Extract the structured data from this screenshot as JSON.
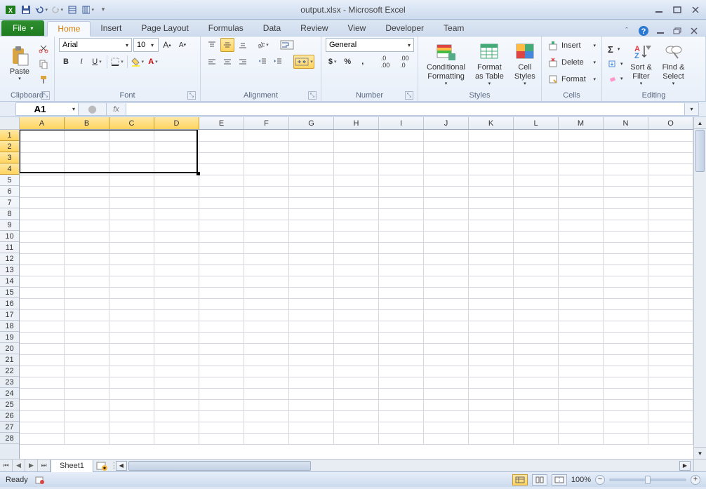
{
  "title": "output.xlsx - Microsoft Excel",
  "qat": {
    "save": "save",
    "undo": "undo",
    "redo": "redo"
  },
  "tabs": {
    "file": "File",
    "items": [
      "Home",
      "Insert",
      "Page Layout",
      "Formulas",
      "Data",
      "Review",
      "View",
      "Developer",
      "Team"
    ],
    "active": "Home"
  },
  "ribbon": {
    "clipboard": {
      "label": "Clipboard",
      "paste": "Paste"
    },
    "font": {
      "label": "Font",
      "name": "Arial",
      "size": "10"
    },
    "alignment": {
      "label": "Alignment"
    },
    "number": {
      "label": "Number",
      "format": "General"
    },
    "styles": {
      "label": "Styles",
      "cond": "Conditional\nFormatting",
      "table": "Format\nas Table",
      "cell": "Cell\nStyles"
    },
    "cells": {
      "label": "Cells",
      "insert": "Insert",
      "delete": "Delete",
      "format": "Format"
    },
    "editing": {
      "label": "Editing",
      "sort": "Sort &\nFilter",
      "find": "Find &\nSelect"
    }
  },
  "namebox": "A1",
  "fx": "fx",
  "columns": [
    "A",
    "B",
    "C",
    "D",
    "E",
    "F",
    "G",
    "H",
    "I",
    "J",
    "K",
    "L",
    "M",
    "N",
    "O"
  ],
  "rows": [
    "1",
    "2",
    "3",
    "4",
    "5",
    "6",
    "7",
    "8",
    "9",
    "10",
    "11",
    "12",
    "13",
    "14",
    "15",
    "16",
    "17",
    "18",
    "19",
    "20",
    "21",
    "22",
    "23",
    "24",
    "25",
    "26",
    "27",
    "28"
  ],
  "selected_cols": [
    "A",
    "B",
    "C",
    "D"
  ],
  "selected_rows": [
    "1",
    "2",
    "3",
    "4"
  ],
  "sheet": {
    "name": "Sheet1"
  },
  "status": {
    "ready": "Ready",
    "zoom": "100%"
  }
}
